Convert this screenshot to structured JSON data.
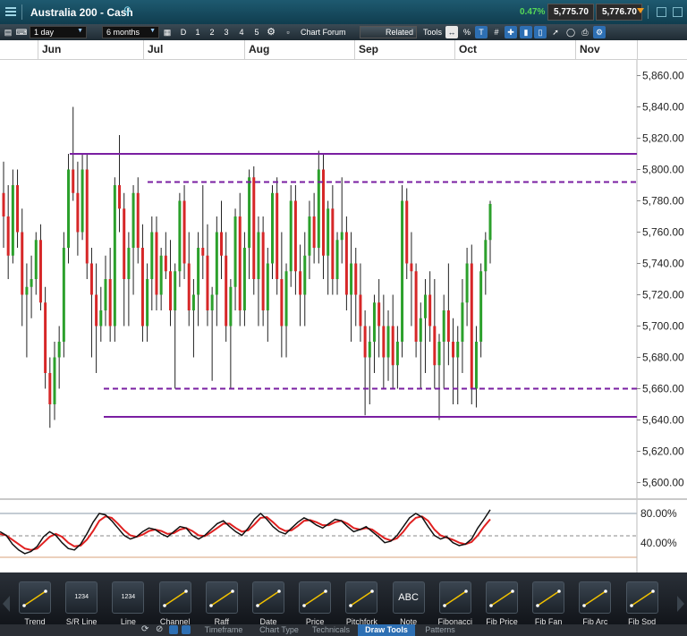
{
  "window": {
    "title": "Australia 200 - Cash",
    "change": "0.47%",
    "bid": "5,775.70",
    "ask": "5,776.70"
  },
  "toolbar": {
    "interval": "1 day",
    "range": "6 months",
    "periods": [
      "D",
      "1",
      "2",
      "3",
      "4",
      "5"
    ],
    "chart_forum": "Chart Forum",
    "related": "Related",
    "tools": "Tools",
    "percent": "%"
  },
  "months": [
    "Jun",
    "Jul",
    "Aug",
    "Sep",
    "Oct",
    "Nov"
  ],
  "colors": {
    "up": "#2ca02c",
    "down": "#d62728",
    "level": "#7a1fa2",
    "osc_fast": "#111111",
    "osc_slow": "#e02020"
  },
  "chart_data": {
    "type": "candlestick",
    "ylim": [
      5590,
      5870
    ],
    "y_ticks": [
      "5,600.00",
      "5,620.00",
      "5,640.00",
      "5,660.00",
      "5,680.00",
      "5,700.00",
      "5,720.00",
      "5,740.00",
      "5,760.00",
      "5,780.00",
      "5,800.00",
      "5,820.00",
      "5,840.00",
      "5,860.00"
    ],
    "levels": [
      {
        "value": 5810,
        "style": "solid"
      },
      {
        "value": 5792,
        "style": "dashed"
      },
      {
        "value": 5660,
        "style": "dashed"
      },
      {
        "value": 5642,
        "style": "solid"
      }
    ],
    "candles": [
      [
        5785,
        5805,
        5750,
        5770
      ],
      [
        5770,
        5790,
        5730,
        5745
      ],
      [
        5745,
        5800,
        5740,
        5790
      ],
      [
        5790,
        5800,
        5750,
        5760
      ],
      [
        5760,
        5775,
        5700,
        5720
      ],
      [
        5720,
        5740,
        5680,
        5725
      ],
      [
        5725,
        5745,
        5705,
        5730
      ],
      [
        5730,
        5760,
        5720,
        5755
      ],
      [
        5755,
        5765,
        5710,
        5715
      ],
      [
        5715,
        5725,
        5660,
        5670
      ],
      [
        5670,
        5680,
        5635,
        5650
      ],
      [
        5650,
        5690,
        5640,
        5680
      ],
      [
        5680,
        5700,
        5660,
        5690
      ],
      [
        5690,
        5760,
        5680,
        5750
      ],
      [
        5750,
        5810,
        5740,
        5800
      ],
      [
        5800,
        5840,
        5780,
        5785
      ],
      [
        5785,
        5805,
        5745,
        5760
      ],
      [
        5760,
        5810,
        5755,
        5800
      ],
      [
        5800,
        5810,
        5730,
        5740
      ],
      [
        5740,
        5750,
        5680,
        5720
      ],
      [
        5720,
        5740,
        5670,
        5700
      ],
      [
        5700,
        5725,
        5690,
        5710
      ],
      [
        5710,
        5745,
        5700,
        5730
      ],
      [
        5730,
        5750,
        5690,
        5700
      ],
      [
        5700,
        5795,
        5690,
        5790
      ],
      [
        5790,
        5822,
        5760,
        5775
      ],
      [
        5775,
        5785,
        5700,
        5730
      ],
      [
        5730,
        5760,
        5700,
        5750
      ],
      [
        5750,
        5790,
        5720,
        5785
      ],
      [
        5785,
        5795,
        5740,
        5750
      ],
      [
        5750,
        5765,
        5690,
        5700
      ],
      [
        5700,
        5740,
        5690,
        5730
      ],
      [
        5730,
        5770,
        5710,
        5760
      ],
      [
        5760,
        5770,
        5710,
        5720
      ],
      [
        5720,
        5750,
        5710,
        5745
      ],
      [
        5745,
        5760,
        5730,
        5735
      ],
      [
        5735,
        5755,
        5700,
        5710
      ],
      [
        5710,
        5740,
        5660,
        5735
      ],
      [
        5735,
        5785,
        5725,
        5780
      ],
      [
        5780,
        5790,
        5730,
        5740
      ],
      [
        5740,
        5760,
        5700,
        5710
      ],
      [
        5710,
        5730,
        5680,
        5720
      ],
      [
        5720,
        5760,
        5700,
        5750
      ],
      [
        5750,
        5790,
        5730,
        5745
      ],
      [
        5745,
        5765,
        5700,
        5710
      ],
      [
        5710,
        5725,
        5665,
        5720
      ],
      [
        5720,
        5770,
        5700,
        5760
      ],
      [
        5760,
        5780,
        5730,
        5745
      ],
      [
        5745,
        5760,
        5690,
        5700
      ],
      [
        5700,
        5730,
        5660,
        5725
      ],
      [
        5725,
        5775,
        5710,
        5770
      ],
      [
        5770,
        5785,
        5700,
        5710
      ],
      [
        5710,
        5760,
        5700,
        5750
      ],
      [
        5750,
        5800,
        5730,
        5795
      ],
      [
        5795,
        5802,
        5720,
        5730
      ],
      [
        5730,
        5770,
        5700,
        5760
      ],
      [
        5760,
        5770,
        5700,
        5710
      ],
      [
        5710,
        5750,
        5690,
        5740
      ],
      [
        5740,
        5790,
        5730,
        5785
      ],
      [
        5785,
        5795,
        5720,
        5730
      ],
      [
        5730,
        5760,
        5680,
        5700
      ],
      [
        5700,
        5740,
        5680,
        5735
      ],
      [
        5735,
        5790,
        5725,
        5780
      ],
      [
        5780,
        5790,
        5720,
        5735
      ],
      [
        5735,
        5752,
        5700,
        5720
      ],
      [
        5720,
        5760,
        5700,
        5745
      ],
      [
        5745,
        5780,
        5730,
        5770
      ],
      [
        5770,
        5785,
        5740,
        5750
      ],
      [
        5750,
        5812,
        5740,
        5800
      ],
      [
        5800,
        5810,
        5730,
        5745
      ],
      [
        5745,
        5780,
        5720,
        5775
      ],
      [
        5775,
        5790,
        5720,
        5730
      ],
      [
        5730,
        5760,
        5720,
        5755
      ],
      [
        5755,
        5795,
        5740,
        5760
      ],
      [
        5760,
        5770,
        5710,
        5720
      ],
      [
        5720,
        5760,
        5690,
        5740
      ],
      [
        5740,
        5750,
        5700,
        5720
      ],
      [
        5720,
        5740,
        5690,
        5700
      ],
      [
        5700,
        5710,
        5643,
        5680
      ],
      [
        5680,
        5700,
        5650,
        5690
      ],
      [
        5690,
        5720,
        5670,
        5715
      ],
      [
        5715,
        5730,
        5680,
        5700
      ],
      [
        5700,
        5720,
        5660,
        5680
      ],
      [
        5680,
        5710,
        5665,
        5700
      ],
      [
        5700,
        5720,
        5660,
        5675
      ],
      [
        5675,
        5700,
        5660,
        5690
      ],
      [
        5690,
        5790,
        5680,
        5780
      ],
      [
        5780,
        5788,
        5730,
        5740
      ],
      [
        5740,
        5760,
        5700,
        5735
      ],
      [
        5735,
        5740,
        5680,
        5690
      ],
      [
        5690,
        5715,
        5660,
        5705
      ],
      [
        5705,
        5730,
        5670,
        5720
      ],
      [
        5720,
        5735,
        5690,
        5700
      ],
      [
        5700,
        5730,
        5660,
        5675
      ],
      [
        5675,
        5695,
        5640,
        5690
      ],
      [
        5690,
        5720,
        5660,
        5710
      ],
      [
        5710,
        5740,
        5675,
        5690
      ],
      [
        5690,
        5705,
        5650,
        5680
      ],
      [
        5680,
        5700,
        5650,
        5690
      ],
      [
        5690,
        5730,
        5670,
        5715
      ],
      [
        5715,
        5750,
        5700,
        5740
      ],
      [
        5740,
        5752,
        5650,
        5660
      ],
      [
        5660,
        5700,
        5648,
        5690
      ],
      [
        5690,
        5740,
        5680,
        5735
      ],
      [
        5735,
        5760,
        5720,
        5755
      ],
      [
        5755,
        5780,
        5740,
        5778
      ]
    ]
  },
  "oscillator": {
    "labels": [
      "80.00%",
      "40.00%"
    ],
    "fast": [
      55,
      50,
      38,
      30,
      25,
      28,
      35,
      48,
      55,
      50,
      40,
      32,
      30,
      38,
      52,
      68,
      80,
      78,
      70,
      60,
      50,
      45,
      48,
      55,
      60,
      58,
      52,
      48,
      55,
      62,
      60,
      50,
      45,
      50,
      58,
      66,
      70,
      62,
      55,
      50,
      60,
      72,
      80,
      72,
      62,
      55,
      52,
      60,
      68,
      74,
      70,
      64,
      60,
      66,
      72,
      70,
      62,
      55,
      58,
      62,
      55,
      48,
      40,
      42,
      50,
      62,
      74,
      80,
      75,
      62,
      50,
      45,
      48,
      40,
      36,
      38,
      45,
      60,
      72,
      85
    ],
    "slow": [
      52,
      50,
      44,
      38,
      32,
      30,
      32,
      40,
      48,
      52,
      48,
      40,
      35,
      36,
      44,
      56,
      70,
      76,
      74,
      66,
      57,
      50,
      48,
      51,
      56,
      58,
      56,
      52,
      53,
      58,
      60,
      56,
      50,
      49,
      54,
      60,
      66,
      66,
      60,
      55,
      57,
      65,
      74,
      75,
      68,
      60,
      56,
      57,
      63,
      70,
      71,
      68,
      64,
      64,
      68,
      70,
      66,
      60,
      58,
      60,
      58,
      52,
      46,
      43,
      46,
      55,
      66,
      74,
      76,
      70,
      58,
      50,
      47,
      44,
      40,
      38,
      41,
      50,
      62,
      72
    ]
  },
  "draw_tools": [
    "Trend",
    "S/R Line",
    "Line",
    "Channel",
    "Raff",
    "Date",
    "Price",
    "Pitchfork",
    "Note",
    "Fibonacci",
    "Fib Price",
    "Fib Fan",
    "Fib Arc",
    "Fib Spd"
  ],
  "draw_tool_glyphs": {
    "S/R Line": "1234",
    "Line": "1234",
    "Note": "ABC"
  },
  "bottom_tabs": [
    "Timeframe",
    "Chart Type",
    "Technicals",
    "Draw Tools",
    "Patterns"
  ],
  "active_tab": "Draw Tools"
}
